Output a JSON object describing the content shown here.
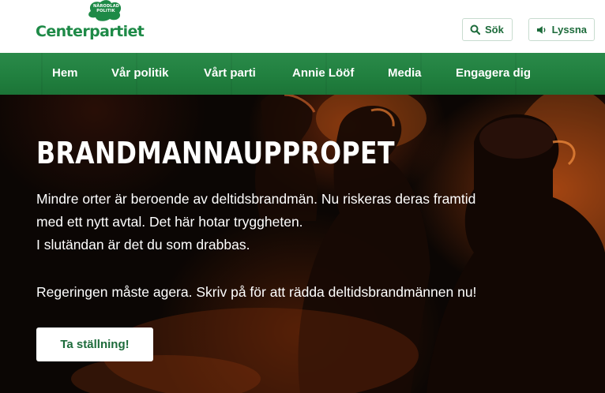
{
  "header": {
    "logo_top": "NÄRODLAD POLITIK",
    "logo_name": "Centerpartiet",
    "search_label": "Sök",
    "listen_label": "Lyssna"
  },
  "nav": {
    "items": [
      "Hem",
      "Vår politik",
      "Vårt parti",
      "Annie Lööf",
      "Media",
      "Engagera dig"
    ]
  },
  "hero": {
    "title": "BRANDMANNAUPPROPET",
    "lines": [
      "Mindre orter är beroende av deltidsbrandmän. Nu riskeras deras framtid",
      "med ett nytt avtal. Det här hotar tryggheten.",
      "I slutändan är det du som drabbas.",
      "Regeringen måste agera. Skriv på för att rädda deltidsbrandmännen nu!"
    ],
    "cta_label": "Ta ställning!"
  },
  "colors": {
    "brand_green": "#1e8a47",
    "nav_green": "#21803f",
    "button_text": "#1d6b3b"
  }
}
